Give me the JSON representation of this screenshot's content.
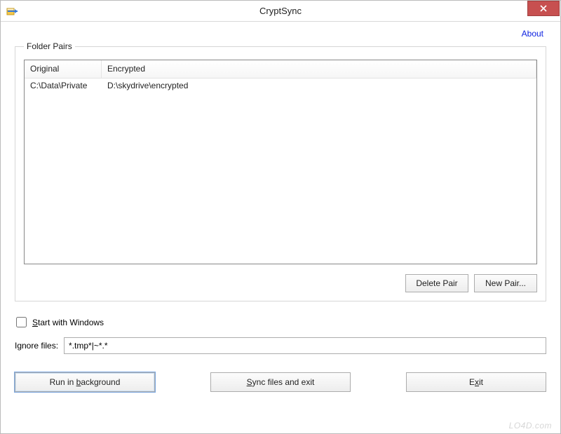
{
  "window": {
    "title": "CryptSync",
    "about_link": "About"
  },
  "folder_pairs": {
    "legend": "Folder Pairs",
    "columns": {
      "original": "Original",
      "encrypted": "Encrypted"
    },
    "rows": [
      {
        "original": "C:\\Data\\Private",
        "encrypted": "D:\\skydrive\\encrypted"
      }
    ],
    "delete_pair_label": "Delete Pair",
    "new_pair_label": "New Pair..."
  },
  "options": {
    "start_with_windows_label_prefix": "S",
    "start_with_windows_label_rest": "tart with Windows",
    "start_with_windows_checked": false,
    "ignore_files_label": "Ignore files:",
    "ignore_files_value": "*.tmp*|~*.*"
  },
  "buttons": {
    "run_bg_prefix": "Run in ",
    "run_bg_ul": "b",
    "run_bg_rest": "ackground",
    "sync_prefix": "",
    "sync_ul": "S",
    "sync_rest": "ync files and exit",
    "exit_prefix": "E",
    "exit_ul": "x",
    "exit_rest": "it"
  },
  "watermark": "LO4D.com"
}
